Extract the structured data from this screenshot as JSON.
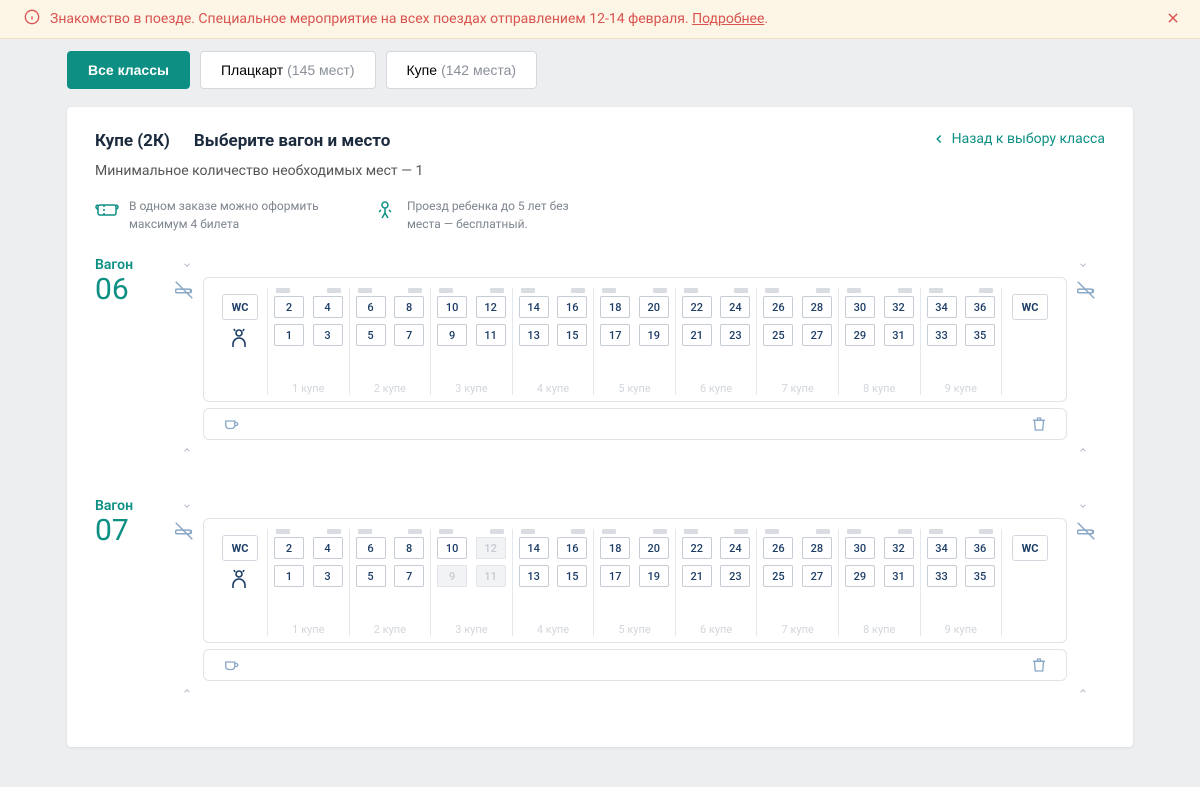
{
  "banner": {
    "text": "Знакомство в поезде. Специальное мероприятие на всех поездах отправлением 12-14 февраля. ",
    "link": "Подробнее",
    "tail": "."
  },
  "tabs": [
    {
      "label": "Все классы",
      "count": "",
      "active": true
    },
    {
      "label": "Плацкарт",
      "count": "(145 мест)",
      "active": false
    },
    {
      "label": "Купе",
      "count": "(142 места)",
      "active": false
    }
  ],
  "panel": {
    "class_title": "Купе (2К)",
    "subtitle": "Выберите вагон и место",
    "back": "Назад к выбору класса",
    "min_note": "Минимальное количество необходимых мест — 1",
    "info1": "В одном заказе можно оформить максимум 4 билета",
    "info2": "Проезд ребенка до 5 лет без места — бесплатный."
  },
  "labels": {
    "wagon": "Вагон",
    "wc": "WC",
    "coupe_word": "купе"
  },
  "wagons": [
    {
      "num": "06",
      "compartments": [
        {
          "l": "1 купе",
          "tl": 2,
          "tr": 4,
          "bl": 1,
          "br": 3,
          "u": []
        },
        {
          "l": "2 купе",
          "tl": 6,
          "tr": 8,
          "bl": 5,
          "br": 7,
          "u": []
        },
        {
          "l": "3 купе",
          "tl": 10,
          "tr": 12,
          "bl": 9,
          "br": 11,
          "u": []
        },
        {
          "l": "4 купе",
          "tl": 14,
          "tr": 16,
          "bl": 13,
          "br": 15,
          "u": []
        },
        {
          "l": "5 купе",
          "tl": 18,
          "tr": 20,
          "bl": 17,
          "br": 19,
          "u": []
        },
        {
          "l": "6 купе",
          "tl": 22,
          "tr": 24,
          "bl": 21,
          "br": 23,
          "u": []
        },
        {
          "l": "7 купе",
          "tl": 26,
          "tr": 28,
          "bl": 25,
          "br": 27,
          "u": []
        },
        {
          "l": "8 купе",
          "tl": 30,
          "tr": 32,
          "bl": 29,
          "br": 31,
          "u": []
        },
        {
          "l": "9 купе",
          "tl": 34,
          "tr": 36,
          "bl": 33,
          "br": 35,
          "u": []
        }
      ]
    },
    {
      "num": "07",
      "compartments": [
        {
          "l": "1 купе",
          "tl": 2,
          "tr": 4,
          "bl": 1,
          "br": 3,
          "u": []
        },
        {
          "l": "2 купе",
          "tl": 6,
          "tr": 8,
          "bl": 5,
          "br": 7,
          "u": []
        },
        {
          "l": "3 купе",
          "tl": 10,
          "tr": 12,
          "bl": 9,
          "br": 11,
          "u": [
            12,
            9,
            11
          ]
        },
        {
          "l": "4 купе",
          "tl": 14,
          "tr": 16,
          "bl": 13,
          "br": 15,
          "u": []
        },
        {
          "l": "5 купе",
          "tl": 18,
          "tr": 20,
          "bl": 17,
          "br": 19,
          "u": []
        },
        {
          "l": "6 купе",
          "tl": 22,
          "tr": 24,
          "bl": 21,
          "br": 23,
          "u": []
        },
        {
          "l": "7 купе",
          "tl": 26,
          "tr": 28,
          "bl": 25,
          "br": 27,
          "u": []
        },
        {
          "l": "8 купе",
          "tl": 30,
          "tr": 32,
          "bl": 29,
          "br": 31,
          "u": []
        },
        {
          "l": "9 купе",
          "tl": 34,
          "tr": 36,
          "bl": 33,
          "br": 35,
          "u": []
        }
      ]
    }
  ]
}
